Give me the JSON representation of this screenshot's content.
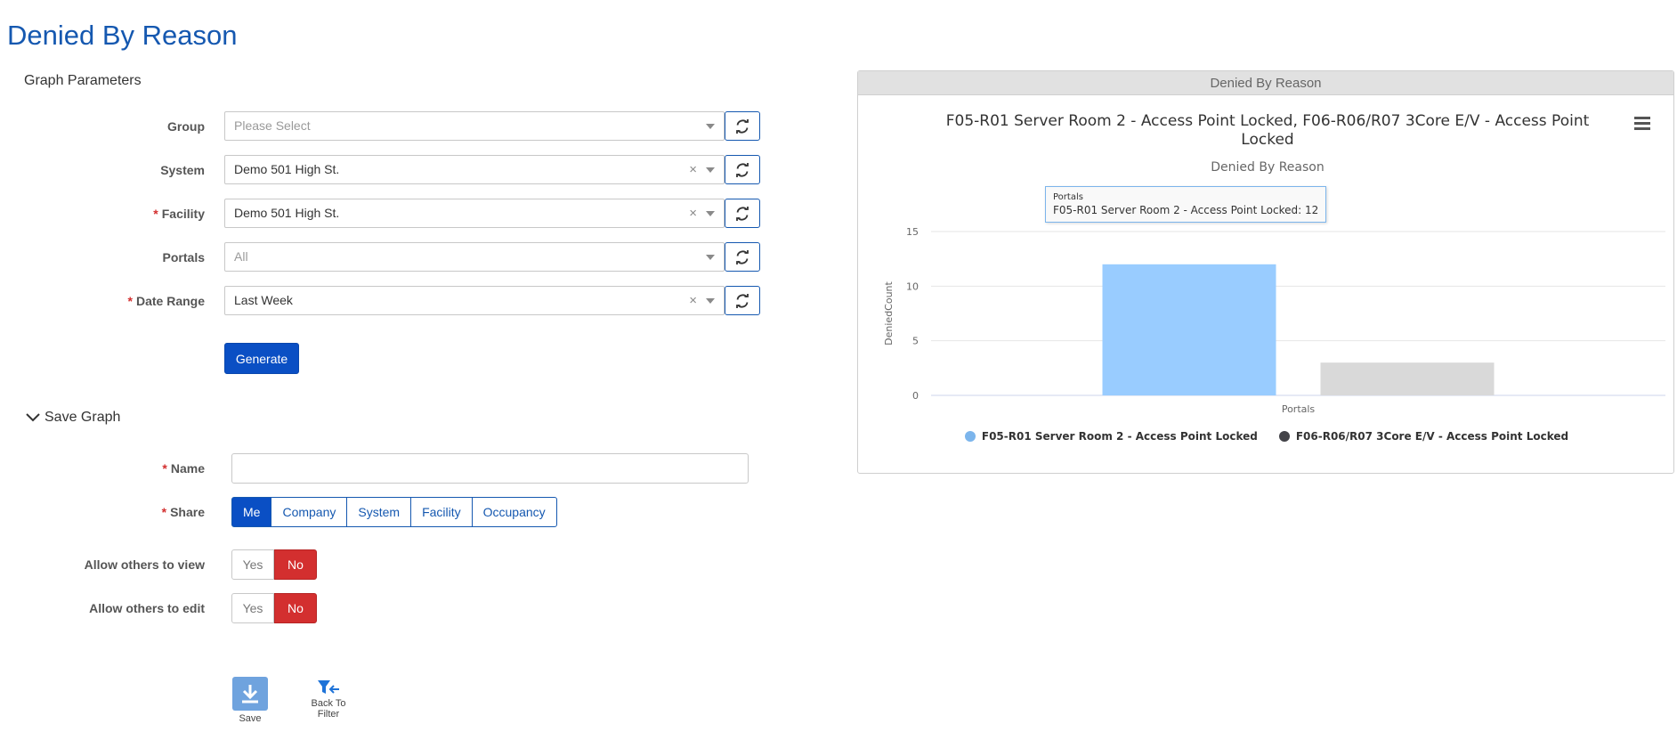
{
  "page": {
    "title": "Denied By Reason"
  },
  "graph_parameters": {
    "title": "Graph Parameters",
    "group": {
      "label": "Group",
      "placeholder": "Please Select",
      "value": ""
    },
    "system": {
      "label": "System",
      "value": "Demo 501 High St."
    },
    "facility": {
      "label": "Facility",
      "value": "Demo 501 High St.",
      "required": "*"
    },
    "portals": {
      "label": "Portals",
      "placeholder": "All",
      "value": ""
    },
    "date_range": {
      "label": "Date Range",
      "value": "Last Week",
      "required": "*"
    },
    "clear_glyph": "×",
    "generate_label": "Generate"
  },
  "save_graph": {
    "title": "Save Graph",
    "name": {
      "label": "Name",
      "required": "*",
      "value": ""
    },
    "share": {
      "label": "Share",
      "required": "*",
      "options": [
        "Me",
        "Company",
        "System",
        "Facility",
        "Occupancy"
      ],
      "selected": "Me"
    },
    "allow_view": {
      "label": "Allow others to view",
      "yes": "Yes",
      "no": "No",
      "selected": "No"
    },
    "allow_edit": {
      "label": "Allow others to edit",
      "yes": "Yes",
      "no": "No",
      "selected": "No"
    },
    "save_label": "Save",
    "back_label": "Back To Filter"
  },
  "chart_panel": {
    "header": "Denied By Reason"
  },
  "chart_data": {
    "type": "bar",
    "title": "F05-R01 Server Room 2 - Access Point Locked, F06-R06/R07 3Core E/V - Access Point Locked",
    "subtitle": "Denied By Reason",
    "categories": [
      "Portals"
    ],
    "xlabel": "Portals",
    "ylabel": "DeniedCount",
    "ylim": [
      0,
      15
    ],
    "yticks": [
      0,
      5,
      10,
      15
    ],
    "grid": true,
    "legend_position": "bottom",
    "series": [
      {
        "name": "F05-R01 Server Room 2 - Access Point Locked",
        "values": [
          12
        ],
        "color": "#99ccff",
        "legend_color": "#7cb5ec"
      },
      {
        "name": "F06-R06/R07 3Core E/V - Access Point Locked",
        "values": [
          3
        ],
        "color": "#d9d9d9",
        "legend_color": "#434348"
      }
    ],
    "tooltip": {
      "header": "Portals",
      "text": "F05-R01 Server Room 2 - Access Point Locked: 12"
    }
  },
  "icons": {
    "refresh": "refresh-icon",
    "menu": "hamburger-menu-icon",
    "chevron": "chevron-down-icon",
    "save": "download-icon",
    "filter": "filter-back-icon"
  },
  "colors": {
    "brand": "#1558b0",
    "primary": "#0a4fc4",
    "danger": "#d32f2f"
  }
}
